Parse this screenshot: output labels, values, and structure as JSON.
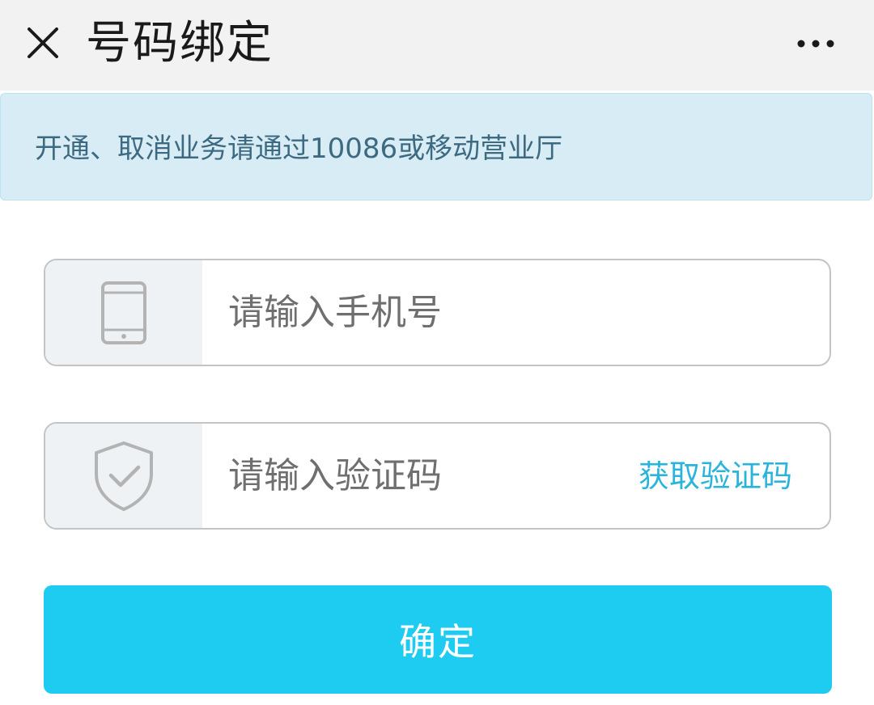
{
  "header": {
    "title": "号码绑定",
    "close_icon": "close-icon",
    "more_icon": "more-icon"
  },
  "notice": {
    "text": "开通、取消业务请通过10086或移动营业厅"
  },
  "phone_field": {
    "icon": "phone-icon",
    "value": "",
    "placeholder": "请输入手机号"
  },
  "code_field": {
    "icon": "shield-check-icon",
    "value": "",
    "placeholder": "请输入验证码",
    "get_code_label": "获取验证码"
  },
  "confirm_button": {
    "label": "确定"
  },
  "colors": {
    "header_bg": "#f2f2f2",
    "notice_bg": "#d8ecf5",
    "notice_text": "#3d6a80",
    "accent": "#1ecbf1",
    "link": "#2ab4dc"
  }
}
